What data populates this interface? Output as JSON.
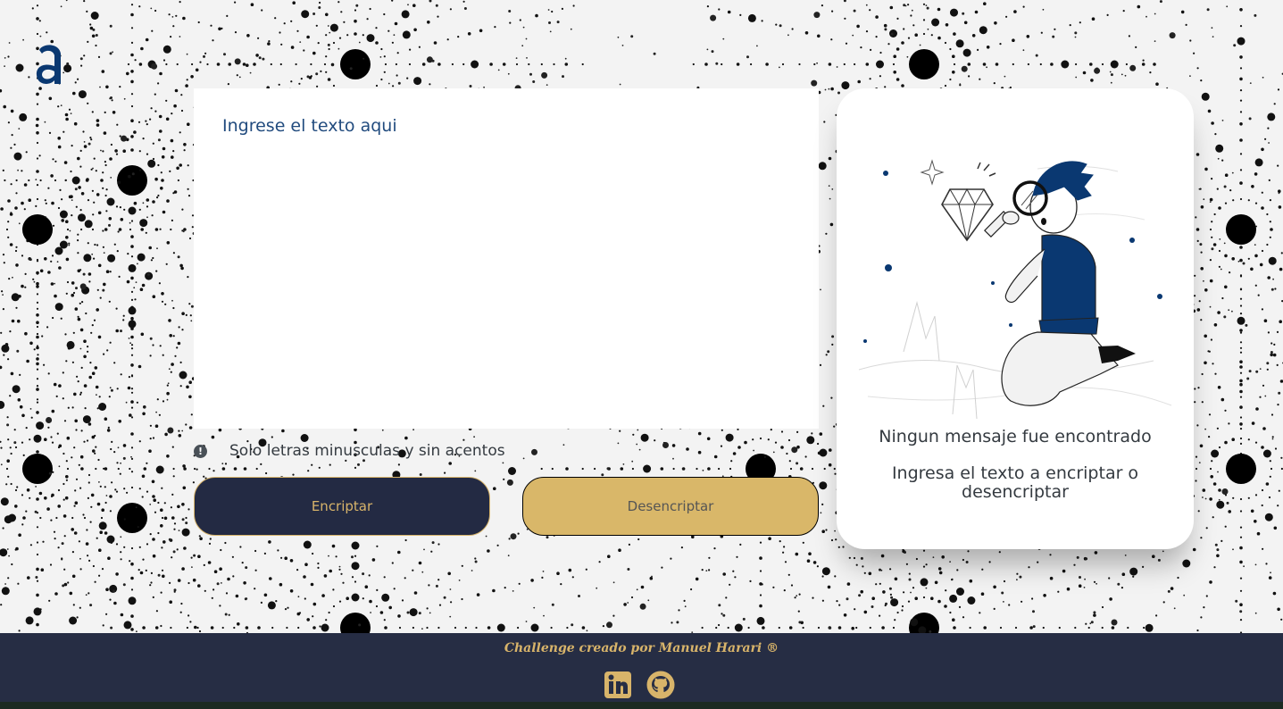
{
  "input": {
    "placeholder": "Ingrese el texto aqui"
  },
  "hint": {
    "icon": "exclamation-circle-icon",
    "text": "Solo letras minusculas y sin acentos"
  },
  "buttons": {
    "encrypt_label": "Encriptar",
    "decrypt_label": "Desencriptar"
  },
  "output": {
    "title": "Ningun mensaje fue encontrado",
    "subtitle": "Ingresa el texto a encriptar o desencriptar"
  },
  "footer": {
    "credit": "Challenge creado por Manuel Harari ®",
    "links": [
      {
        "icon": "linkedin-icon"
      },
      {
        "icon": "github-icon"
      }
    ]
  },
  "colors": {
    "primary_navy": "#232a43",
    "accent_gold": "#d9b769",
    "text_blue": "#0a3871",
    "background": "#f3f3f3"
  }
}
